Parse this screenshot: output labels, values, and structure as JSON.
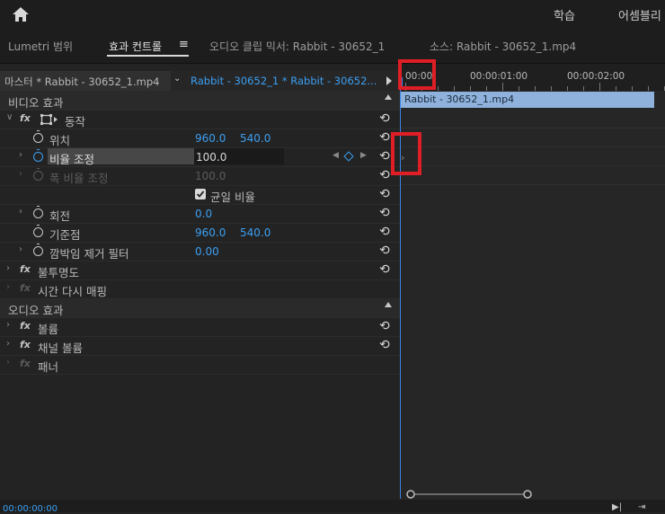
{
  "top_nav": {
    "learn": "학습",
    "assembly": "어셈블리"
  },
  "tabs": [
    {
      "label": "Lumetri 범위",
      "active": false
    },
    {
      "label": "효과 컨트롤",
      "active": true
    },
    {
      "label": "오디오 클립 믹서: Rabbit - 30652_1",
      "active": false
    },
    {
      "label": "소스: Rabbit - 30652_1.mp4",
      "active": false
    }
  ],
  "tab_menu_glyph": "≡",
  "source": {
    "master": "마스터 * Rabbit - 30652_1.mp4",
    "sequence": "Rabbit - 30652_1 * Rabbit - 30652..."
  },
  "timeline": {
    "ruler": [
      "00:00",
      "00:00:01:00",
      "00:00:02:00"
    ],
    "clip_name": "Rabbit - 30652_1.mp4"
  },
  "video_section": "비디오 효과",
  "audio_section": "오디오 효과",
  "motion": {
    "label": "동작",
    "properties": [
      {
        "label": "위치",
        "v1": "960.0",
        "v2": "540.0",
        "dim": false
      },
      {
        "label": "비율 조정",
        "v1": "100.0",
        "v2": "",
        "dim": false
      },
      {
        "label": "폭 비율 조정",
        "v1": "100.0",
        "v2": "",
        "dim": true
      },
      {
        "label": "균일 비율",
        "v1": "",
        "v2": "",
        "dim": false
      },
      {
        "label": "회전",
        "v1": "0.0",
        "v2": "",
        "dim": false
      },
      {
        "label": "기준점",
        "v1": "960.0",
        "v2": "540.0",
        "dim": false
      },
      {
        "label": "깜박임 제거 필터",
        "v1": "0.00",
        "v2": "",
        "dim": false
      }
    ]
  },
  "opacity": "불투명도",
  "time_remap": "시간 다시 매핑",
  "audio_effects": [
    "볼륨",
    "채널 볼륨",
    "패너"
  ],
  "timecode": "00:00:00:00",
  "icons": {
    "home": "home-icon",
    "reset": "reset-icon",
    "stopwatch": "stopwatch-icon",
    "fx": "fx-badge",
    "checkbox": "checkbox-icon"
  },
  "colors": {
    "accent": "#3c9ff2",
    "highlight": "#e01e26",
    "clip": "#8fb2dc"
  }
}
